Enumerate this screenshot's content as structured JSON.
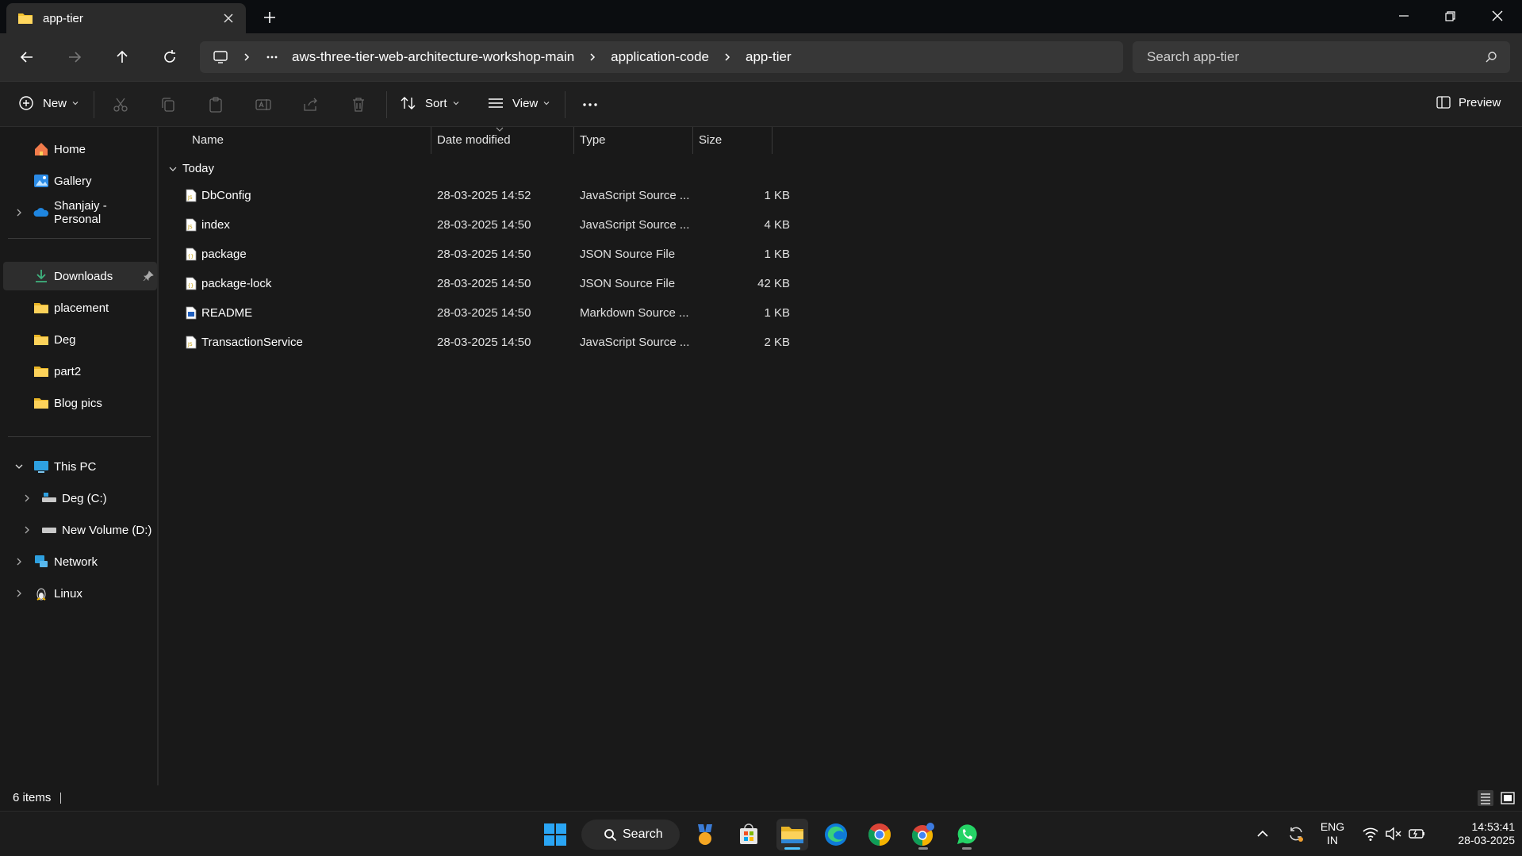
{
  "window": {
    "tab_title": "app-tier",
    "new_tab_label": "+"
  },
  "address": {
    "crumbs": [
      "aws-three-tier-web-architecture-workshop-main",
      "application-code",
      "app-tier"
    ],
    "search_placeholder": "Search app-tier"
  },
  "toolbar": {
    "new_label": "New",
    "sort_label": "Sort",
    "view_label": "View",
    "preview_label": "Preview"
  },
  "sidebar": {
    "quick": [
      {
        "label": "Home",
        "icon": "home-icon"
      },
      {
        "label": "Gallery",
        "icon": "gallery-icon"
      },
      {
        "label": "Shanjaiy - Personal",
        "icon": "onedrive-icon"
      }
    ],
    "pinned": [
      {
        "label": "Downloads",
        "icon": "download-icon"
      },
      {
        "label": "placement",
        "icon": "folder-icon"
      },
      {
        "label": "Deg",
        "icon": "folder-icon"
      },
      {
        "label": "part2",
        "icon": "folder-icon"
      },
      {
        "label": "Blog pics",
        "icon": "folder-icon"
      }
    ],
    "devices": [
      {
        "label": "This PC",
        "icon": "pc-icon"
      },
      {
        "label": "Deg (C:)",
        "icon": "drive-icon"
      },
      {
        "label": "New Volume (D:)",
        "icon": "drive-icon"
      },
      {
        "label": "Network",
        "icon": "network-icon"
      },
      {
        "label": "Linux",
        "icon": "linux-icon"
      }
    ]
  },
  "columns": {
    "name": "Name",
    "date": "Date modified",
    "type": "Type",
    "size": "Size"
  },
  "group_label": "Today",
  "files": [
    {
      "name": "DbConfig",
      "date": "28-03-2025 14:52",
      "type": "JavaScript Source ...",
      "size": "1 KB",
      "icon": "js-file-icon"
    },
    {
      "name": "index",
      "date": "28-03-2025 14:50",
      "type": "JavaScript Source ...",
      "size": "4 KB",
      "icon": "js-file-icon"
    },
    {
      "name": "package",
      "date": "28-03-2025 14:50",
      "type": "JSON Source File",
      "size": "1 KB",
      "icon": "json-file-icon"
    },
    {
      "name": "package-lock",
      "date": "28-03-2025 14:50",
      "type": "JSON Source File",
      "size": "42 KB",
      "icon": "json-file-icon"
    },
    {
      "name": "README",
      "date": "28-03-2025 14:50",
      "type": "Markdown Source ...",
      "size": "1 KB",
      "icon": "markdown-file-icon"
    },
    {
      "name": "TransactionService",
      "date": "28-03-2025 14:50",
      "type": "JavaScript Source ...",
      "size": "2 KB",
      "icon": "js-file-icon"
    }
  ],
  "status": {
    "item_count": "6 items"
  },
  "taskbar": {
    "search_label": "Search",
    "lang_line1": "ENG",
    "lang_line2": "IN",
    "time": "14:53:41",
    "date": "28-03-2025"
  },
  "colors": {
    "accent": "#4cc2ff",
    "folder": "#f4c430"
  }
}
